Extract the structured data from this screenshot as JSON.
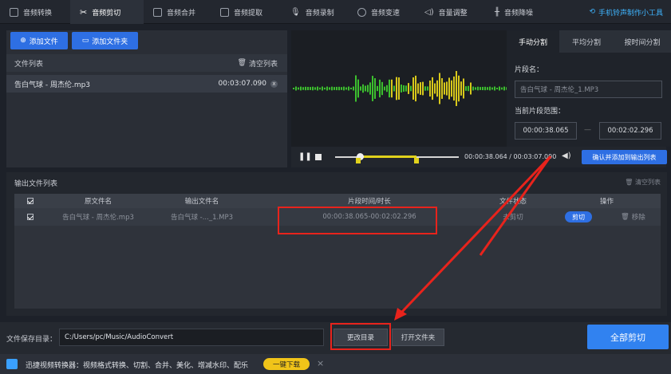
{
  "tabs": [
    {
      "label": "音频转换",
      "icon": "convert-icon",
      "active": false
    },
    {
      "label": "音频剪切",
      "icon": "scissors-icon",
      "active": true
    },
    {
      "label": "音频合并",
      "icon": "merge-icon",
      "active": false
    },
    {
      "label": "音频提取",
      "icon": "extract-icon",
      "active": false
    },
    {
      "label": "音频录制",
      "icon": "mic-icon",
      "active": false
    },
    {
      "label": "音频变速",
      "icon": "speed-icon",
      "active": false
    },
    {
      "label": "音量调整",
      "icon": "volume-icon",
      "active": false
    },
    {
      "label": "音频降噪",
      "icon": "denoise-icon",
      "active": false
    }
  ],
  "corner_link": "手机铃声制作小工具",
  "left_panel": {
    "add_file": "添加文件",
    "add_folder": "添加文件夹",
    "list_title": "文件列表",
    "clear_list": "清空列表",
    "file_name": "告白气球 - 周杰伦.mp3",
    "file_duration": "00:03:07.090"
  },
  "player": {
    "current_time": "00:00:38.064",
    "separator": "/",
    "total_time": "00:03:07.090",
    "confirm_btn": "确认并添加到输出列表",
    "progress": 0.203
  },
  "right_panel": {
    "tabs": [
      "手动分割",
      "平均分割",
      "按时间分割"
    ],
    "segment_name_label": "片段名：",
    "segment_name_value": "告白气球 - 周杰伦_1.MP3",
    "range_label": "当前片段范围：",
    "range_start": "00:00:38.065",
    "range_sep": "—",
    "range_end": "00:02:02.296"
  },
  "output": {
    "title": "输出文件列表",
    "clear": "清空列表",
    "headers": [
      "原文件名",
      "输出文件名",
      "片段时间/时长",
      "文件状态",
      "操作"
    ],
    "row": {
      "src": "告白气球 - 周杰伦.mp3",
      "out": "告白气球 -..._1.MP3",
      "range": "00:00:38.065-00:02:02.296",
      "status": "未剪切",
      "cut_btn": "剪切",
      "remove": "移除"
    }
  },
  "bottom": {
    "save_label": "文件保存目录：",
    "save_path": "C:/Users/pc/Music/AudioConvert",
    "change_dir": "更改目录",
    "open_folder": "打开文件夹",
    "cut_all": "全部剪切"
  },
  "promo": {
    "text": "迅捷视频转换器：视频格式转换、切割、合并、美化、增减水印、配乐",
    "download": "一键下载",
    "close": "×"
  },
  "colors": {
    "accent": "#2e6fe3",
    "annotation": "#e8231c",
    "wave_green": "#3cc02e",
    "wave_yellow": "#d8c81b"
  }
}
